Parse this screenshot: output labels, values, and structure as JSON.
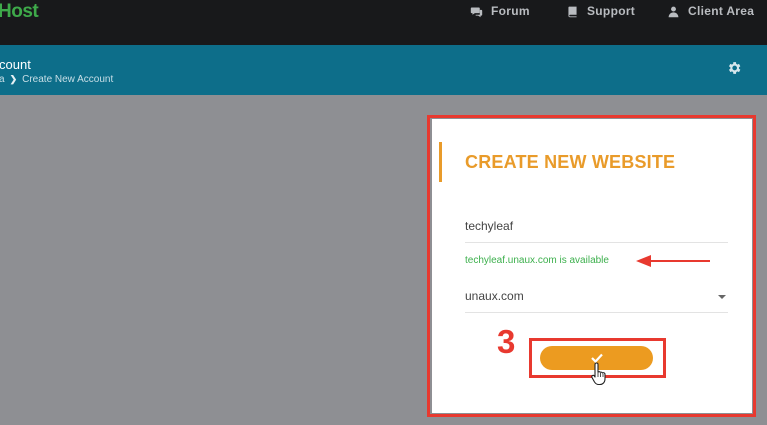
{
  "header": {
    "brand": "Host",
    "nav": [
      {
        "label": "Forum",
        "icon": "chat-icon"
      },
      {
        "label": "Support",
        "icon": "book-icon"
      },
      {
        "label": "Client Area",
        "icon": "user-icon"
      }
    ]
  },
  "page": {
    "title": "count",
    "breadcrumb": [
      "a",
      "Create New Account"
    ]
  },
  "card": {
    "title": "CREATE NEW WEBSITE",
    "name_value": "techyleaf",
    "availability": "techyleaf.unaux.com is available",
    "domain_value": "unaux.com"
  },
  "annotation": {
    "step": "3"
  },
  "colors": {
    "accent": "#ec9b20",
    "header": "#0d6e8a",
    "available": "#3db04d",
    "highlight": "#e8392f"
  }
}
